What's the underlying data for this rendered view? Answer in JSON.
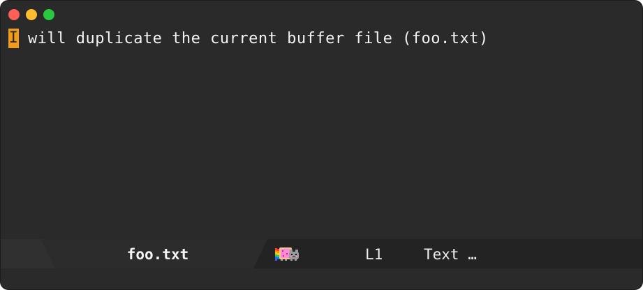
{
  "window": {
    "controls": [
      "close",
      "minimize",
      "maximize"
    ]
  },
  "buffer": {
    "cursor_char": "I",
    "text": "will duplicate the current buffer file (foo.txt)"
  },
  "modeline": {
    "filename": "foo.txt",
    "position_icon": "nyan-cat-icon",
    "line": "L1",
    "major_mode": "Text …"
  },
  "colors": {
    "background": "#2a2a2a",
    "cursor": "#f39c1a",
    "text": "#f2f2f2",
    "close": "#fe5f57",
    "minimize": "#febc2e",
    "maximize": "#28c840"
  }
}
